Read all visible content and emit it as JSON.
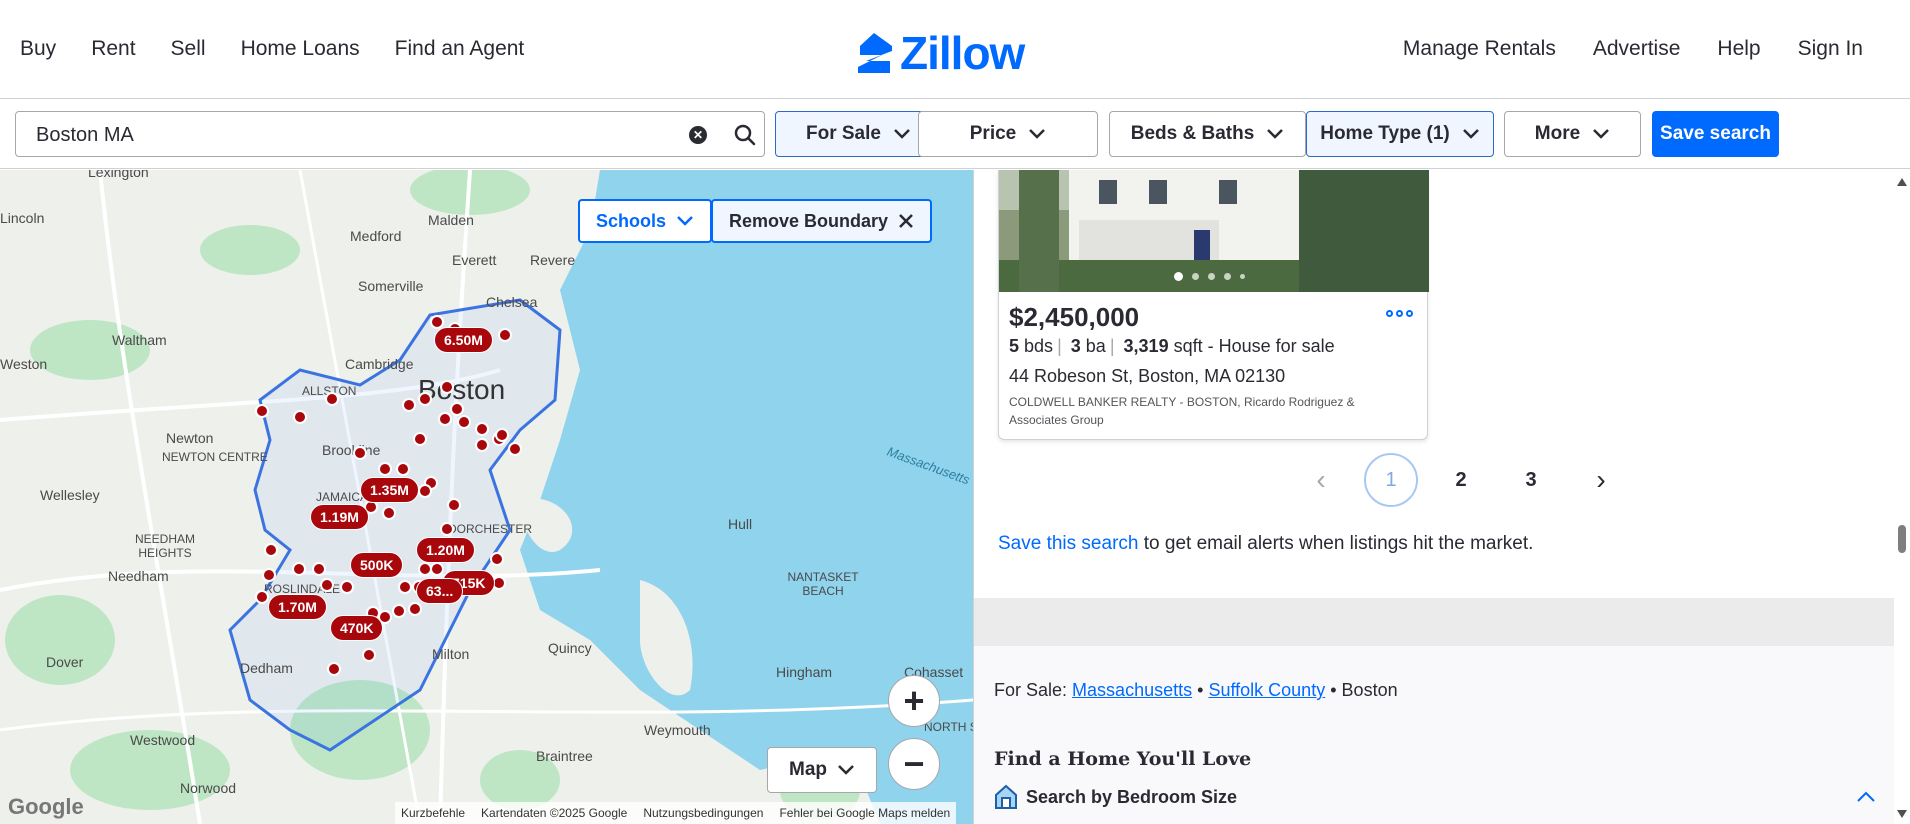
{
  "nav": {
    "left": [
      "Buy",
      "Rent",
      "Sell",
      "Home Loans",
      "Find an Agent"
    ],
    "logo": "Zillow",
    "right": [
      "Manage Rentals",
      "Advertise",
      "Help",
      "Sign In"
    ]
  },
  "search": {
    "value": "Boston MA"
  },
  "filters": {
    "for_sale": "For Sale",
    "price": "Price",
    "beds_baths": "Beds & Baths",
    "home_type": "Home Type (1)",
    "more": "More",
    "save_search": "Save search"
  },
  "map": {
    "schools": "Schools",
    "remove_boundary": "Remove Boundary",
    "map_type": "Map",
    "labels": [
      "Lexington",
      "Lincoln",
      "Medford",
      "Malden",
      "Everett",
      "Revere",
      "Somerville",
      "Chelsea",
      "Waltham",
      "Cambridge",
      "Weston",
      "ALLSTON",
      "Boston",
      "Newton",
      "NEWTON CENTRE",
      "Brookline",
      "Wellesley",
      "JAMAICA",
      "NEEDHAM HEIGHTS",
      "DORCHESTER",
      "Hull",
      "Needham",
      "ROSLINDALE",
      "NANTASKET BEACH",
      "Quincy",
      "Dover",
      "Dedham",
      "Milton",
      "Hingham",
      "Cohasset",
      "Westwood",
      "Weymouth",
      "Braintree",
      "Norwood",
      "NORTH SC",
      "Massachusetts"
    ],
    "price_pins": [
      "6.50M",
      "1.35M",
      "1.19M",
      "1.20M",
      "500K",
      "715K",
      "63...",
      "1.70M",
      "470K"
    ],
    "attribution": [
      "Kurzbefehle",
      "Kartendaten ©2025 Google",
      "Nutzungsbedingungen",
      "Fehler bei Google Maps melden"
    ],
    "google": "Google",
    "zoom_in": "+",
    "zoom_out": "−"
  },
  "listing": {
    "price": "$2,450,000",
    "beds": "5",
    "beds_unit": "bds",
    "baths": "3",
    "baths_unit": "ba",
    "sqft": "3,319",
    "sqft_unit": "sqft - House for sale",
    "address": "44 Robeson St, Boston, MA 02130",
    "broker": "COLDWELL BANKER REALTY - BOSTON, Ricardo Rodriguez & Associates Group",
    "photo_count": 5,
    "photo_index": 1
  },
  "pagination": {
    "pages": [
      "1",
      "2",
      "3"
    ],
    "current": "1"
  },
  "alert": {
    "link": "Save this search",
    "text": " to get email alerts when listings hit the market."
  },
  "breadcrumbs": {
    "prefix": "For Sale:",
    "state": "Massachusetts",
    "county": "Suffolk County",
    "city": "Boston",
    "bullet": "•"
  },
  "find_home": {
    "title": "Find a Home You'll Love",
    "bedroom_section": "Search by Bedroom Size"
  },
  "colors": {
    "brand": "#006aff",
    "pin": "#a8070b",
    "water": "#8fd3ec",
    "park": "#bfe6c4"
  }
}
